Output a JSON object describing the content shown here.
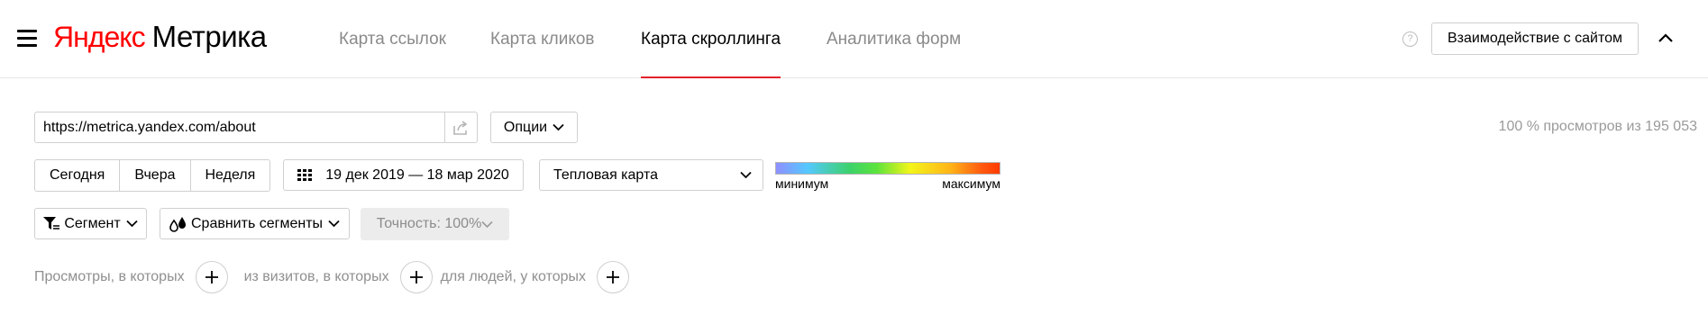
{
  "header": {
    "logo_brand": "Яндекс",
    "logo_product": "Метрика",
    "tabs": [
      {
        "label": "Карта ссылок"
      },
      {
        "label": "Карта кликов"
      },
      {
        "label": "Карта скроллинга",
        "active": true
      },
      {
        "label": "Аналитика форм"
      }
    ],
    "help_glyph": "?",
    "interact_label": "Взаимодействие с сайтом"
  },
  "controls": {
    "url": "https://metrica.yandex.com/about",
    "options_label": "Опции",
    "views_count": "100 % просмотров из 195 053",
    "periods": [
      "Сегодня",
      "Вчера",
      "Неделя"
    ],
    "date_range": "19 дек 2019 — 18 мар 2020",
    "map_type": "Тепловая карта",
    "heat_min": "минимум",
    "heat_max": "максимум",
    "segment_label": "Сегмент",
    "compare_label": "Сравнить сегменты",
    "precision_label": "Точность: 100%"
  },
  "filters": {
    "views": "Просмотры, в которых",
    "visits": "из визитов, в которых",
    "people": "для людей, у которых"
  },
  "colors": {
    "brand_red": "#ff0000",
    "active_underline": "#e4202c",
    "muted_text": "#8a8a8a"
  },
  "icons": [
    "menu-icon",
    "help-icon",
    "chevron-up-icon",
    "share-icon",
    "chevron-down-icon",
    "calendar-icon",
    "filter-icon",
    "compare-drops-icon",
    "plus-icon"
  ]
}
